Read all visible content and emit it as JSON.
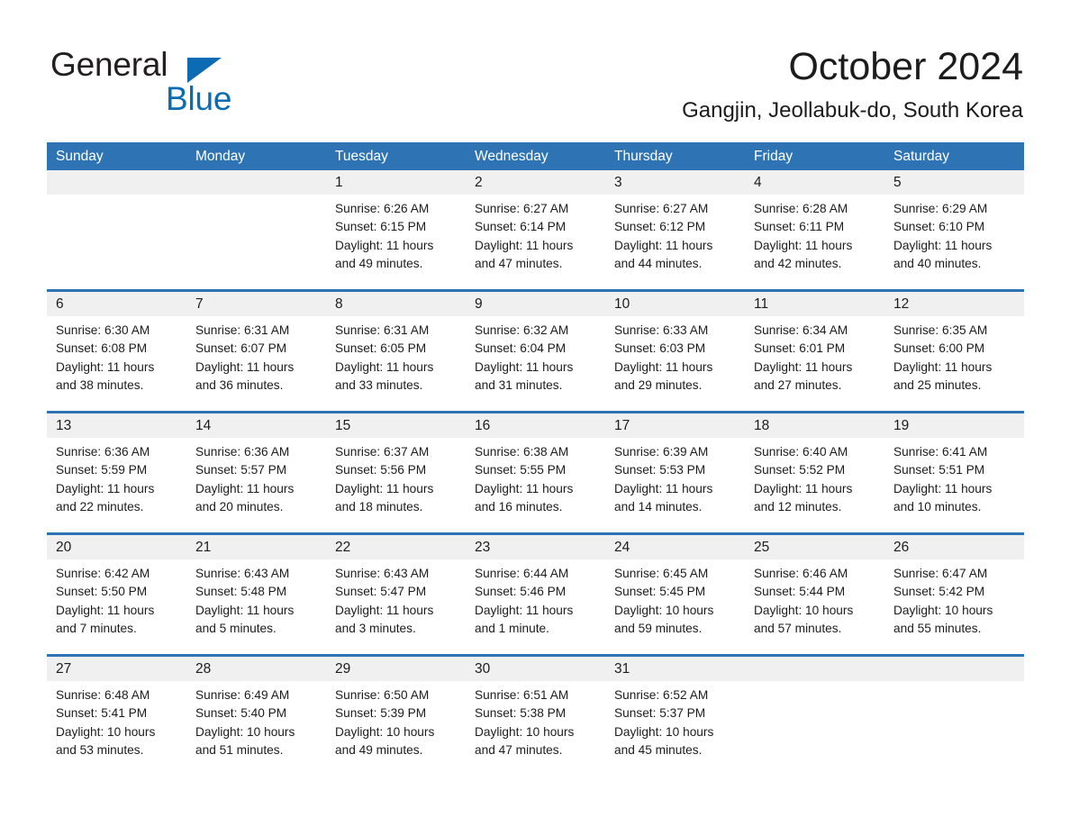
{
  "logo": {
    "word_one": "General",
    "word_two": "Blue",
    "triangle_color": "#0b6cb3",
    "text_color": "#231f20"
  },
  "header": {
    "month_title": "October 2024",
    "location": "Gangjin, Jeollabuk-do, South Korea"
  },
  "theme": {
    "header_blue": "#2e74b5",
    "day_band_gray": "#f0f0f0",
    "text_color": "#1c1c1c",
    "page_background": "#ffffff"
  },
  "calendar": {
    "weekdays": [
      "Sunday",
      "Monday",
      "Tuesday",
      "Wednesday",
      "Thursday",
      "Friday",
      "Saturday"
    ],
    "weeks": [
      [
        {
          "day": "",
          "sunrise": "",
          "sunset": "",
          "daylight_line1": "",
          "daylight_line2": "",
          "empty": true
        },
        {
          "day": "",
          "sunrise": "",
          "sunset": "",
          "daylight_line1": "",
          "daylight_line2": "",
          "empty": true
        },
        {
          "day": "1",
          "sunrise": "Sunrise: 6:26 AM",
          "sunset": "Sunset: 6:15 PM",
          "daylight_line1": "Daylight: 11 hours",
          "daylight_line2": "and 49 minutes.",
          "empty": false
        },
        {
          "day": "2",
          "sunrise": "Sunrise: 6:27 AM",
          "sunset": "Sunset: 6:14 PM",
          "daylight_line1": "Daylight: 11 hours",
          "daylight_line2": "and 47 minutes.",
          "empty": false
        },
        {
          "day": "3",
          "sunrise": "Sunrise: 6:27 AM",
          "sunset": "Sunset: 6:12 PM",
          "daylight_line1": "Daylight: 11 hours",
          "daylight_line2": "and 44 minutes.",
          "empty": false
        },
        {
          "day": "4",
          "sunrise": "Sunrise: 6:28 AM",
          "sunset": "Sunset: 6:11 PM",
          "daylight_line1": "Daylight: 11 hours",
          "daylight_line2": "and 42 minutes.",
          "empty": false
        },
        {
          "day": "5",
          "sunrise": "Sunrise: 6:29 AM",
          "sunset": "Sunset: 6:10 PM",
          "daylight_line1": "Daylight: 11 hours",
          "daylight_line2": "and 40 minutes.",
          "empty": false
        }
      ],
      [
        {
          "day": "6",
          "sunrise": "Sunrise: 6:30 AM",
          "sunset": "Sunset: 6:08 PM",
          "daylight_line1": "Daylight: 11 hours",
          "daylight_line2": "and 38 minutes.",
          "empty": false
        },
        {
          "day": "7",
          "sunrise": "Sunrise: 6:31 AM",
          "sunset": "Sunset: 6:07 PM",
          "daylight_line1": "Daylight: 11 hours",
          "daylight_line2": "and 36 minutes.",
          "empty": false
        },
        {
          "day": "8",
          "sunrise": "Sunrise: 6:31 AM",
          "sunset": "Sunset: 6:05 PM",
          "daylight_line1": "Daylight: 11 hours",
          "daylight_line2": "and 33 minutes.",
          "empty": false
        },
        {
          "day": "9",
          "sunrise": "Sunrise: 6:32 AM",
          "sunset": "Sunset: 6:04 PM",
          "daylight_line1": "Daylight: 11 hours",
          "daylight_line2": "and 31 minutes.",
          "empty": false
        },
        {
          "day": "10",
          "sunrise": "Sunrise: 6:33 AM",
          "sunset": "Sunset: 6:03 PM",
          "daylight_line1": "Daylight: 11 hours",
          "daylight_line2": "and 29 minutes.",
          "empty": false
        },
        {
          "day": "11",
          "sunrise": "Sunrise: 6:34 AM",
          "sunset": "Sunset: 6:01 PM",
          "daylight_line1": "Daylight: 11 hours",
          "daylight_line2": "and 27 minutes.",
          "empty": false
        },
        {
          "day": "12",
          "sunrise": "Sunrise: 6:35 AM",
          "sunset": "Sunset: 6:00 PM",
          "daylight_line1": "Daylight: 11 hours",
          "daylight_line2": "and 25 minutes.",
          "empty": false
        }
      ],
      [
        {
          "day": "13",
          "sunrise": "Sunrise: 6:36 AM",
          "sunset": "Sunset: 5:59 PM",
          "daylight_line1": "Daylight: 11 hours",
          "daylight_line2": "and 22 minutes.",
          "empty": false
        },
        {
          "day": "14",
          "sunrise": "Sunrise: 6:36 AM",
          "sunset": "Sunset: 5:57 PM",
          "daylight_line1": "Daylight: 11 hours",
          "daylight_line2": "and 20 minutes.",
          "empty": false
        },
        {
          "day": "15",
          "sunrise": "Sunrise: 6:37 AM",
          "sunset": "Sunset: 5:56 PM",
          "daylight_line1": "Daylight: 11 hours",
          "daylight_line2": "and 18 minutes.",
          "empty": false
        },
        {
          "day": "16",
          "sunrise": "Sunrise: 6:38 AM",
          "sunset": "Sunset: 5:55 PM",
          "daylight_line1": "Daylight: 11 hours",
          "daylight_line2": "and 16 minutes.",
          "empty": false
        },
        {
          "day": "17",
          "sunrise": "Sunrise: 6:39 AM",
          "sunset": "Sunset: 5:53 PM",
          "daylight_line1": "Daylight: 11 hours",
          "daylight_line2": "and 14 minutes.",
          "empty": false
        },
        {
          "day": "18",
          "sunrise": "Sunrise: 6:40 AM",
          "sunset": "Sunset: 5:52 PM",
          "daylight_line1": "Daylight: 11 hours",
          "daylight_line2": "and 12 minutes.",
          "empty": false
        },
        {
          "day": "19",
          "sunrise": "Sunrise: 6:41 AM",
          "sunset": "Sunset: 5:51 PM",
          "daylight_line1": "Daylight: 11 hours",
          "daylight_line2": "and 10 minutes.",
          "empty": false
        }
      ],
      [
        {
          "day": "20",
          "sunrise": "Sunrise: 6:42 AM",
          "sunset": "Sunset: 5:50 PM",
          "daylight_line1": "Daylight: 11 hours",
          "daylight_line2": "and 7 minutes.",
          "empty": false
        },
        {
          "day": "21",
          "sunrise": "Sunrise: 6:43 AM",
          "sunset": "Sunset: 5:48 PM",
          "daylight_line1": "Daylight: 11 hours",
          "daylight_line2": "and 5 minutes.",
          "empty": false
        },
        {
          "day": "22",
          "sunrise": "Sunrise: 6:43 AM",
          "sunset": "Sunset: 5:47 PM",
          "daylight_line1": "Daylight: 11 hours",
          "daylight_line2": "and 3 minutes.",
          "empty": false
        },
        {
          "day": "23",
          "sunrise": "Sunrise: 6:44 AM",
          "sunset": "Sunset: 5:46 PM",
          "daylight_line1": "Daylight: 11 hours",
          "daylight_line2": "and 1 minute.",
          "empty": false
        },
        {
          "day": "24",
          "sunrise": "Sunrise: 6:45 AM",
          "sunset": "Sunset: 5:45 PM",
          "daylight_line1": "Daylight: 10 hours",
          "daylight_line2": "and 59 minutes.",
          "empty": false
        },
        {
          "day": "25",
          "sunrise": "Sunrise: 6:46 AM",
          "sunset": "Sunset: 5:44 PM",
          "daylight_line1": "Daylight: 10 hours",
          "daylight_line2": "and 57 minutes.",
          "empty": false
        },
        {
          "day": "26",
          "sunrise": "Sunrise: 6:47 AM",
          "sunset": "Sunset: 5:42 PM",
          "daylight_line1": "Daylight: 10 hours",
          "daylight_line2": "and 55 minutes.",
          "empty": false
        }
      ],
      [
        {
          "day": "27",
          "sunrise": "Sunrise: 6:48 AM",
          "sunset": "Sunset: 5:41 PM",
          "daylight_line1": "Daylight: 10 hours",
          "daylight_line2": "and 53 minutes.",
          "empty": false
        },
        {
          "day": "28",
          "sunrise": "Sunrise: 6:49 AM",
          "sunset": "Sunset: 5:40 PM",
          "daylight_line1": "Daylight: 10 hours",
          "daylight_line2": "and 51 minutes.",
          "empty": false
        },
        {
          "day": "29",
          "sunrise": "Sunrise: 6:50 AM",
          "sunset": "Sunset: 5:39 PM",
          "daylight_line1": "Daylight: 10 hours",
          "daylight_line2": "and 49 minutes.",
          "empty": false
        },
        {
          "day": "30",
          "sunrise": "Sunrise: 6:51 AM",
          "sunset": "Sunset: 5:38 PM",
          "daylight_line1": "Daylight: 10 hours",
          "daylight_line2": "and 47 minutes.",
          "empty": false
        },
        {
          "day": "31",
          "sunrise": "Sunrise: 6:52 AM",
          "sunset": "Sunset: 5:37 PM",
          "daylight_line1": "Daylight: 10 hours",
          "daylight_line2": "and 45 minutes.",
          "empty": false
        },
        {
          "day": "",
          "sunrise": "",
          "sunset": "",
          "daylight_line1": "",
          "daylight_line2": "",
          "empty": true
        },
        {
          "day": "",
          "sunrise": "",
          "sunset": "",
          "daylight_line1": "",
          "daylight_line2": "",
          "empty": true
        }
      ]
    ]
  }
}
